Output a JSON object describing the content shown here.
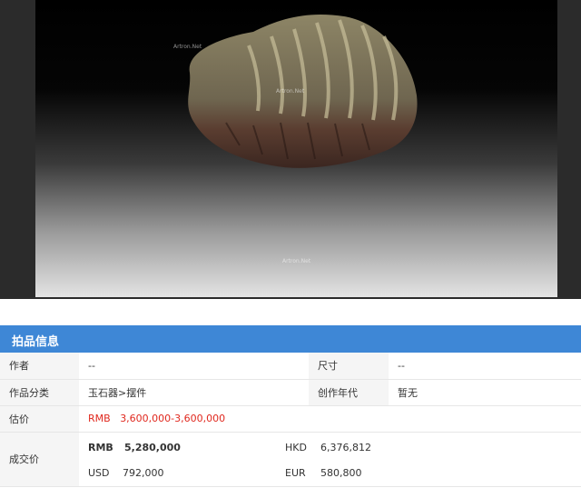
{
  "image": {
    "watermarks": [
      "Artron.Net",
      "Artron.Net",
      "Artron.Net"
    ]
  },
  "section": {
    "title": "拍品信息"
  },
  "info": {
    "author_label": "作者",
    "author_value": "--",
    "size_label": "尺寸",
    "size_value": "--",
    "category_label": "作品分类",
    "category_value": "玉石器>摆件",
    "year_label": "创作年代",
    "year_value": "暂无",
    "estimate_label": "估价",
    "estimate_currency": "RMB",
    "estimate_value": "3,600,000-3,600,000",
    "deal_label": "成交价",
    "deal": {
      "rmb_currency": "RMB",
      "rmb_value": "5,280,000",
      "hkd_currency": "HKD",
      "hkd_value": "6,376,812",
      "usd_currency": "USD",
      "usd_value": "792,000",
      "eur_currency": "EUR",
      "eur_value": "580,800"
    }
  },
  "colors": {
    "header_bg": "#3e87d6",
    "estimate_red": "#e0281e"
  }
}
